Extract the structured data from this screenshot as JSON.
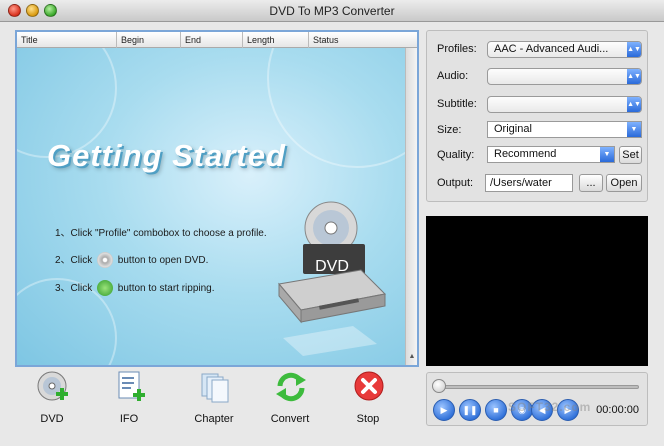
{
  "window": {
    "title": "DVD To MP3 Converter"
  },
  "list": {
    "columns": [
      "Title",
      "Begin",
      "End",
      "Length",
      "Status"
    ]
  },
  "splash": {
    "title": "Getting Started",
    "step1": "1、Click \"Profile\" combobox to choose a profile.",
    "step2_pre": "2、Click",
    "step2_post": "button to open DVD.",
    "step3_pre": "3、Click",
    "step3_post": "button to start ripping.",
    "art_label": "DVD"
  },
  "settings": {
    "profiles_label": "Profiles:",
    "profiles_value": "AAC - Advanced Audi...",
    "audio_label": "Audio:",
    "audio_value": "",
    "subtitle_label": "Subtitle:",
    "subtitle_value": "",
    "size_label": "Size:",
    "size_value": "Original",
    "quality_label": "Quality:",
    "quality_value": "Recommend",
    "set_label": "Set",
    "output_label": "Output:",
    "output_value": "/Users/water",
    "browse_label": "...",
    "open_label": "Open"
  },
  "toolbar": {
    "dvd": "DVD",
    "ifo": "IFO",
    "chapter": "Chapter",
    "convert": "Convert",
    "stop": "Stop"
  },
  "player": {
    "time": "00:00:00",
    "progress": 0
  },
  "watermark": "SOFT32.com"
}
